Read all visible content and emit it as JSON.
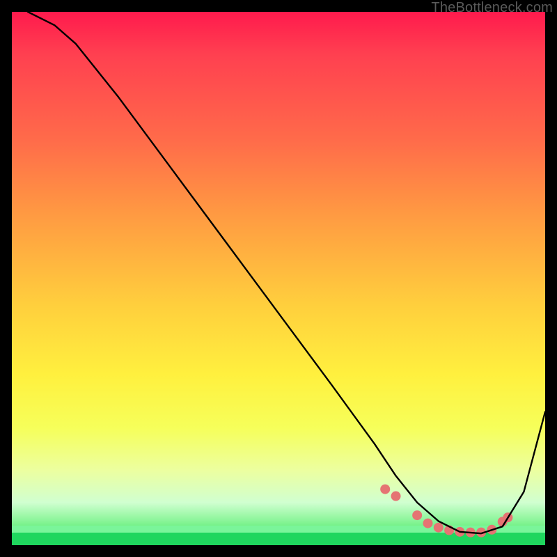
{
  "watermark": "TheBottleneck.com",
  "chart_data": {
    "type": "line",
    "title": "",
    "xlabel": "",
    "ylabel": "",
    "xlim": [
      0,
      100
    ],
    "ylim": [
      0,
      100
    ],
    "grid": false,
    "series": [
      {
        "name": "primary-curve",
        "color": "#000000",
        "x": [
          3,
          5,
          8,
          12,
          20,
          30,
          40,
          50,
          60,
          68,
          72,
          76,
          80,
          84,
          88,
          92,
          96,
          100
        ],
        "y": [
          100,
          99,
          97.5,
          94,
          84,
          70.5,
          57,
          43.5,
          30,
          19,
          13,
          8,
          4.5,
          2.5,
          2.2,
          3.5,
          10,
          25
        ]
      }
    ],
    "dots": {
      "name": "highlight-dots",
      "color": "#e57373",
      "radius_px": 7,
      "x": [
        70,
        72,
        76,
        78,
        80,
        82,
        84,
        86,
        88,
        90,
        92,
        93
      ],
      "y": [
        10.5,
        9.2,
        5.6,
        4.1,
        3.3,
        2.8,
        2.5,
        2.4,
        2.4,
        2.9,
        4.4,
        5.2
      ]
    }
  }
}
